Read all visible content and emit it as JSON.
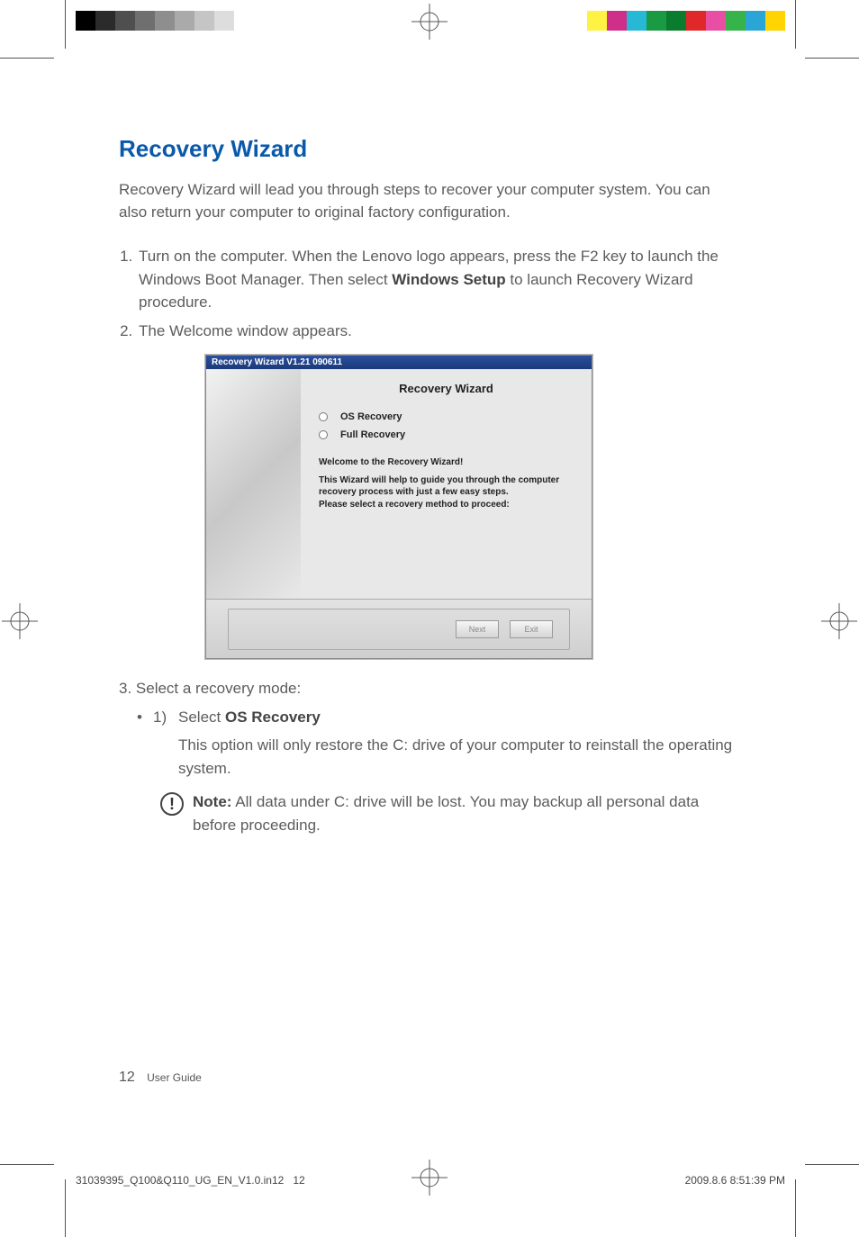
{
  "heading": "Recovery Wizard",
  "intro": "Recovery Wizard will lead you through steps to recover your computer system. You can also return your computer to original factory configuration.",
  "steps": {
    "s1_a": "Turn on the computer. When the Lenovo logo appears, press the F2 key to launch the Windows Boot Manager. Then select ",
    "s1_bold": "Windows Setup",
    "s1_b": " to launch Recovery Wizard procedure.",
    "s2": "The Welcome window appears."
  },
  "screenshot": {
    "titlebar": "Recovery Wizard V1.21 090611",
    "title": "Recovery Wizard",
    "opt1": "OS Recovery",
    "opt2": "Full Recovery",
    "desc1": "Welcome to the Recovery Wizard!",
    "desc2": "This Wizard will help to guide you through the computer recovery process with just a few easy steps.",
    "desc3": "Please select a recovery method to proceed:",
    "btn_next": "Next",
    "btn_exit": "Exit"
  },
  "step3": {
    "lead": "3. Select a recovery mode:",
    "bullet": "•",
    "num": "1)",
    "select_prefix": "Select ",
    "select_bold": "OS Recovery",
    "desc": "This option will only restore the C: drive of your computer to reinstall the operating system.",
    "note_label": "Note:",
    "note_body": " All data under C: drive will be lost. You may backup all personal data before proceeding."
  },
  "footer": {
    "page_num": "12",
    "book": "User Guide"
  },
  "slug": {
    "left_a": "31039395_Q100&Q110_UG_EN_V1.0.in12",
    "left_b": "12",
    "right": "2009.8.6   8:51:39 PM"
  },
  "colorbar_left": [
    "#000",
    "#2b2b2b",
    "#4f4f4f",
    "#6f6f6f",
    "#8e8e8e",
    "#aaa",
    "#c5c5c5",
    "#ddd",
    "#fff"
  ],
  "colorbar_right": [
    "#fff242",
    "#ce2f89",
    "#27b8d6",
    "#1a9a42",
    "#0a7c2e",
    "#e02828",
    "#e84fa4",
    "#36b34a",
    "#2aa6d6",
    "#ffd400"
  ]
}
